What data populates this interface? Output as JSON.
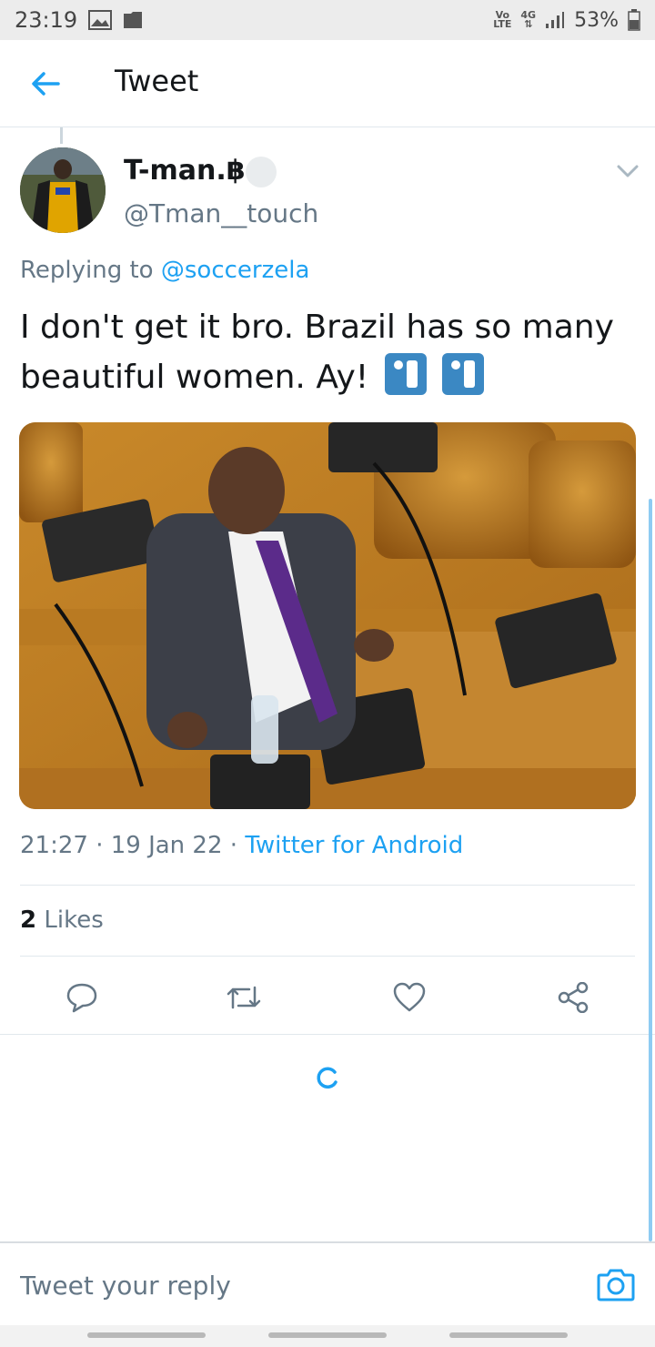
{
  "status_bar": {
    "time": "23:19",
    "volte_top": "Vo",
    "volte_bottom": "LTE",
    "network": "4G",
    "battery": "53%"
  },
  "header": {
    "title": "Tweet"
  },
  "tweet": {
    "display_name": "T-man.฿.",
    "handle": "@Tman__touch",
    "replying_prefix": "Replying to",
    "replying_to": "@soccerzela",
    "text": "I don't get it bro. Brazil has so many beautiful women. Ay!",
    "time": "21:27",
    "date": "19 Jan 22",
    "separator": "·",
    "source": "Twitter for Android",
    "likes_count": "2",
    "likes_label": "Likes"
  },
  "icons": {
    "back": "arrow-left-icon",
    "more": "chevron-down-icon",
    "reply": "reply-icon",
    "retweet": "retweet-icon",
    "like": "heart-icon",
    "share": "share-icon",
    "camera": "camera-icon",
    "emoji": "man-toilet-emoji"
  },
  "reply_bar": {
    "placeholder": "Tweet your reply"
  },
  "colors": {
    "accent": "#1da1f2",
    "secondary_text": "#657786",
    "divider": "#e1e8ed"
  }
}
